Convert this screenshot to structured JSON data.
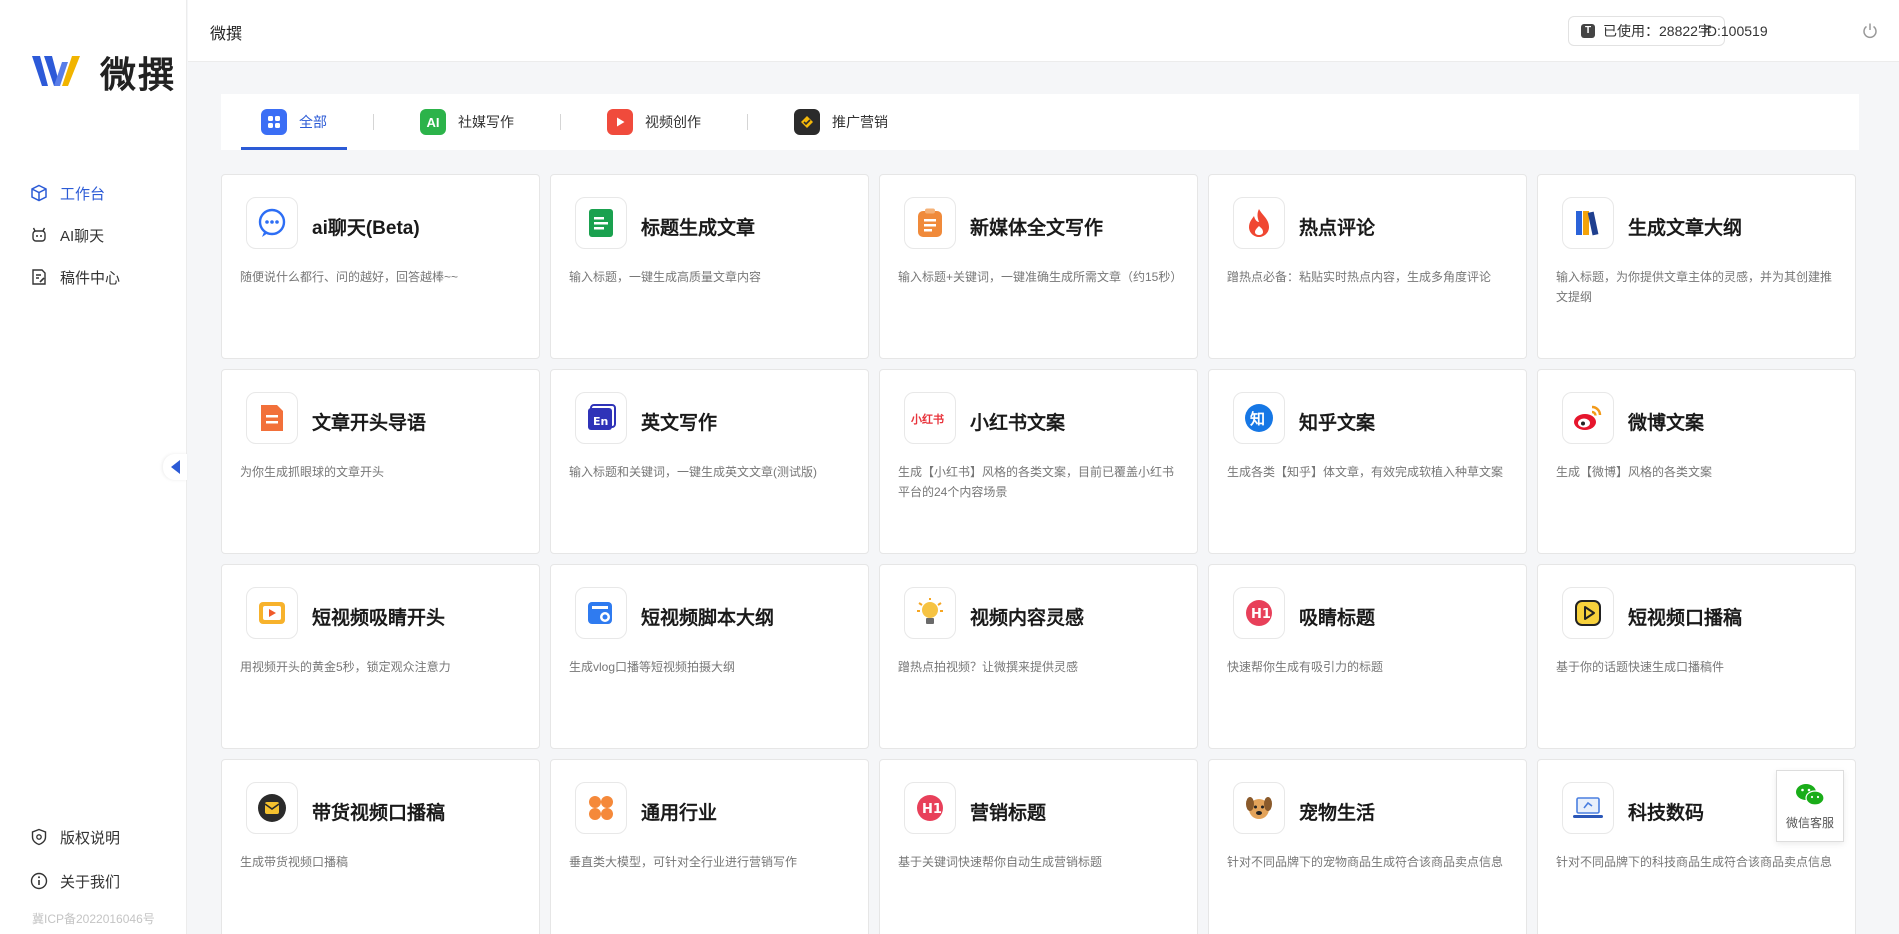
{
  "app": {
    "logo_text": "微撰"
  },
  "sidebar": {
    "items": [
      {
        "label": "工作台",
        "icon": "cube-icon",
        "active": true
      },
      {
        "label": "AI聊天",
        "icon": "robot-icon",
        "active": false
      },
      {
        "label": "稿件中心",
        "icon": "document-edit-icon",
        "active": false
      }
    ],
    "bottom_items": [
      {
        "label": "版权说明",
        "icon": "shield-icon"
      },
      {
        "label": "关于我们",
        "icon": "info-icon"
      }
    ],
    "icp": "冀ICP备2022016046号"
  },
  "header": {
    "title": "微撰",
    "usage": "已使用：28822字",
    "user_id": "ID:100519"
  },
  "tabs": [
    {
      "label": "全部",
      "active": true,
      "color": "#3b6ef5"
    },
    {
      "label": "社媒写作",
      "active": false,
      "color": "#2cb34a"
    },
    {
      "label": "视频创作",
      "active": false,
      "color": "#f04b3c"
    },
    {
      "label": "推广营销",
      "active": false,
      "color": "#2b2b2b"
    }
  ],
  "cards": [
    {
      "title": "ai聊天(Beta)",
      "desc": "随便说什么都行、问的越好，回答越棒~~",
      "icon": "chat-bubble-icon"
    },
    {
      "title": "标题生成文章",
      "desc": "输入标题，一键生成高质量文章内容",
      "icon": "green-doc-icon"
    },
    {
      "title": "新媒体全文写作",
      "desc": "输入标题+关键词，一键准确生成所需文章（约15秒）",
      "icon": "clipboard-icon"
    },
    {
      "title": "热点评论",
      "desc": "蹭热点必备：粘贴实时热点内容，生成多角度评论",
      "icon": "flame-icon"
    },
    {
      "title": "生成文章大纲",
      "desc": "输入标题，为你提供文章主体的灵感，并为其创建推文提纲",
      "icon": "books-icon"
    },
    {
      "title": "文章开头导语",
      "desc": "为你生成抓眼球的文章开头",
      "icon": "orange-doc-icon"
    },
    {
      "title": "英文写作",
      "desc": "输入标题和关键词，一键生成英文文章(测试版)",
      "icon": "english-icon"
    },
    {
      "title": "小红书文案",
      "desc": "生成【小红书】风格的各类文案，目前已覆盖小红书平台的24个内容场景",
      "icon": "xiaohongshu-icon"
    },
    {
      "title": "知乎文案",
      "desc": "生成各类【知乎】体文章，有效完成软植入种草文案",
      "icon": "zhihu-icon"
    },
    {
      "title": "微博文案",
      "desc": "生成【微博】风格的各类文案",
      "icon": "weibo-icon"
    },
    {
      "title": "短视频吸睛开头",
      "desc": "用视频开头的黄金5秒，锁定观众注意力",
      "icon": "video-play-icon"
    },
    {
      "title": "短视频脚本大纲",
      "desc": "生成vlog口播等短视频拍摄大纲",
      "icon": "script-icon"
    },
    {
      "title": "视频内容灵感",
      "desc": "蹭热点拍视频？让微撰来提供灵感",
      "icon": "lightbulb-icon"
    },
    {
      "title": "吸睛标题",
      "desc": "快速帮你生成有吸引力的标题",
      "icon": "h1-icon"
    },
    {
      "title": "短视频口播稿",
      "desc": "基于你的话题快速生成口播稿件",
      "icon": "play-square-icon"
    },
    {
      "title": "带货视频口播稿",
      "desc": "生成带货视频口播稿",
      "icon": "mail-icon"
    },
    {
      "title": "通用行业",
      "desc": "垂直类大模型，可针对全行业进行营销写作",
      "icon": "grid-icon"
    },
    {
      "title": "营销标题",
      "desc": "基于关键词快速帮你自动生成营销标题",
      "icon": "h1-red-icon"
    },
    {
      "title": "宠物生活",
      "desc": "针对不同品牌下的宠物商品生成符合该商品卖点信息",
      "icon": "dog-icon"
    },
    {
      "title": "科技数码",
      "desc": "针对不同品牌下的科技商品生成符合该商品卖点信息",
      "icon": "laptop-icon"
    }
  ],
  "wechat_service": {
    "label": "微信客服"
  }
}
